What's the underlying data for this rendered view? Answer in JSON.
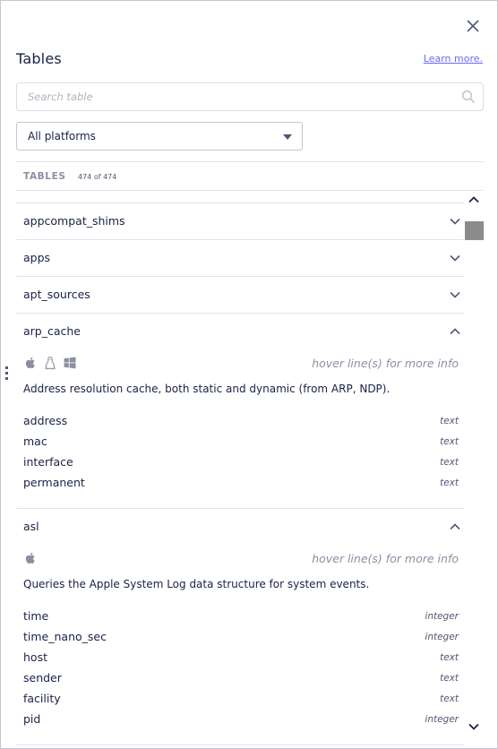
{
  "header": {
    "title": "Tables",
    "learn_more": "Learn more.",
    "close_icon": "close-icon"
  },
  "search": {
    "placeholder": "Search table",
    "value": "",
    "icon": "search-icon"
  },
  "platform_select": {
    "selected": "All platforms"
  },
  "list_header": {
    "label": "TABLES",
    "count": "474 of 474"
  },
  "tables": [
    {
      "name": "appcompat_shims",
      "expanded": false
    },
    {
      "name": "apps",
      "expanded": false
    },
    {
      "name": "apt_sources",
      "expanded": false
    }
  ],
  "expanded_tables": [
    {
      "name": "arp_cache",
      "platforms": [
        "apple-icon",
        "linux-icon",
        "windows-icon"
      ],
      "hint": "hover line(s) for more info",
      "description": "Address resolution cache, both static and dynamic (from ARP, NDP).",
      "columns": [
        {
          "name": "address",
          "type": "text"
        },
        {
          "name": "mac",
          "type": "text"
        },
        {
          "name": "interface",
          "type": "text"
        },
        {
          "name": "permanent",
          "type": "text"
        }
      ]
    },
    {
      "name": "asl",
      "platforms": [
        "apple-icon"
      ],
      "hint": "hover line(s) for more info",
      "description": "Queries the Apple System Log data structure for system events.",
      "columns": [
        {
          "name": "time",
          "type": "integer"
        },
        {
          "name": "time_nano_sec",
          "type": "integer"
        },
        {
          "name": "host",
          "type": "text"
        },
        {
          "name": "sender",
          "type": "text"
        },
        {
          "name": "facility",
          "type": "text"
        },
        {
          "name": "pid",
          "type": "integer"
        }
      ]
    }
  ],
  "colors": {
    "text": "#192147",
    "muted": "#8b8fa2",
    "link": "#6a67fe",
    "border": "#e2e4ea",
    "scroll_thumb": "#8b8b8b"
  }
}
